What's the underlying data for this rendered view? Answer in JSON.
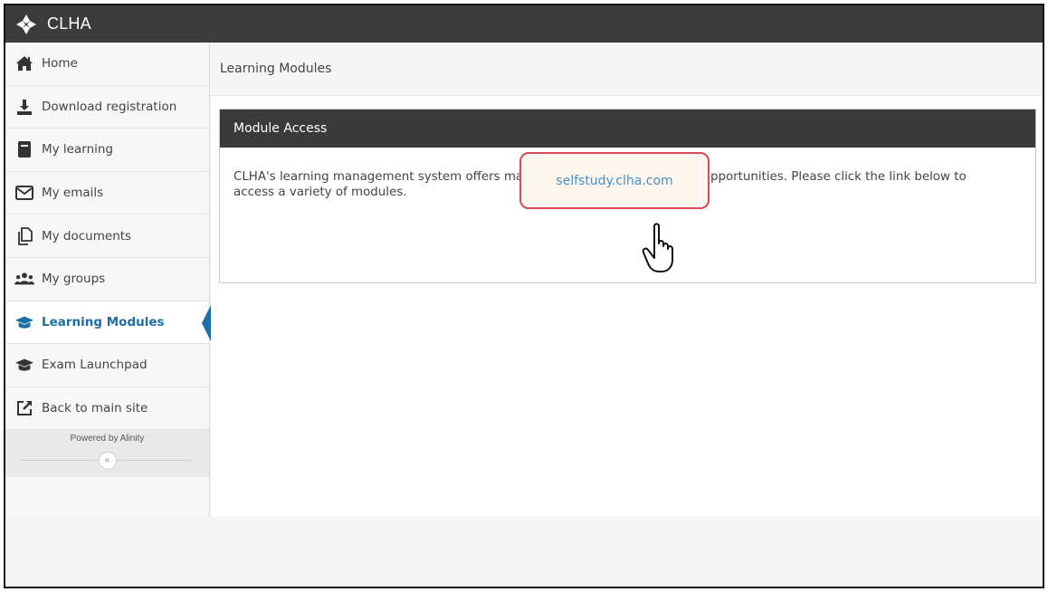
{
  "app": {
    "title": "CLHA",
    "logo_icon": "clha-logo-icon"
  },
  "sidebar": {
    "items": [
      {
        "label": "Home",
        "icon": "home-icon",
        "active": false
      },
      {
        "label": "Download registration",
        "icon": "download-icon",
        "active": false
      },
      {
        "label": "My learning",
        "icon": "book-icon",
        "active": false
      },
      {
        "label": "My emails",
        "icon": "envelope-icon",
        "active": false
      },
      {
        "label": "My documents",
        "icon": "documents-icon",
        "active": false
      },
      {
        "label": "My groups",
        "icon": "users-icon",
        "active": false
      },
      {
        "label": "Learning Modules",
        "icon": "graduation-cap-icon",
        "active": true
      },
      {
        "label": "Exam Launchpad",
        "icon": "graduation-cap-icon",
        "active": false
      },
      {
        "label": "Back to main site",
        "icon": "external-link-icon",
        "active": false
      }
    ],
    "powered_by": "Powered by Alinity",
    "collapse_label": "«"
  },
  "main": {
    "breadcrumb": "Learning Modules",
    "panel": {
      "title": "Module Access",
      "body": "CLHA's learning management system offers many professional development opportunities. Please click the link below to access a variety of modules.",
      "link_text": "selfstudy.clha.com"
    }
  },
  "colors": {
    "topbar": "#3b3b3b",
    "accent": "#1e6fa6",
    "link": "#4a90c2",
    "highlight_border": "#d9485a"
  }
}
